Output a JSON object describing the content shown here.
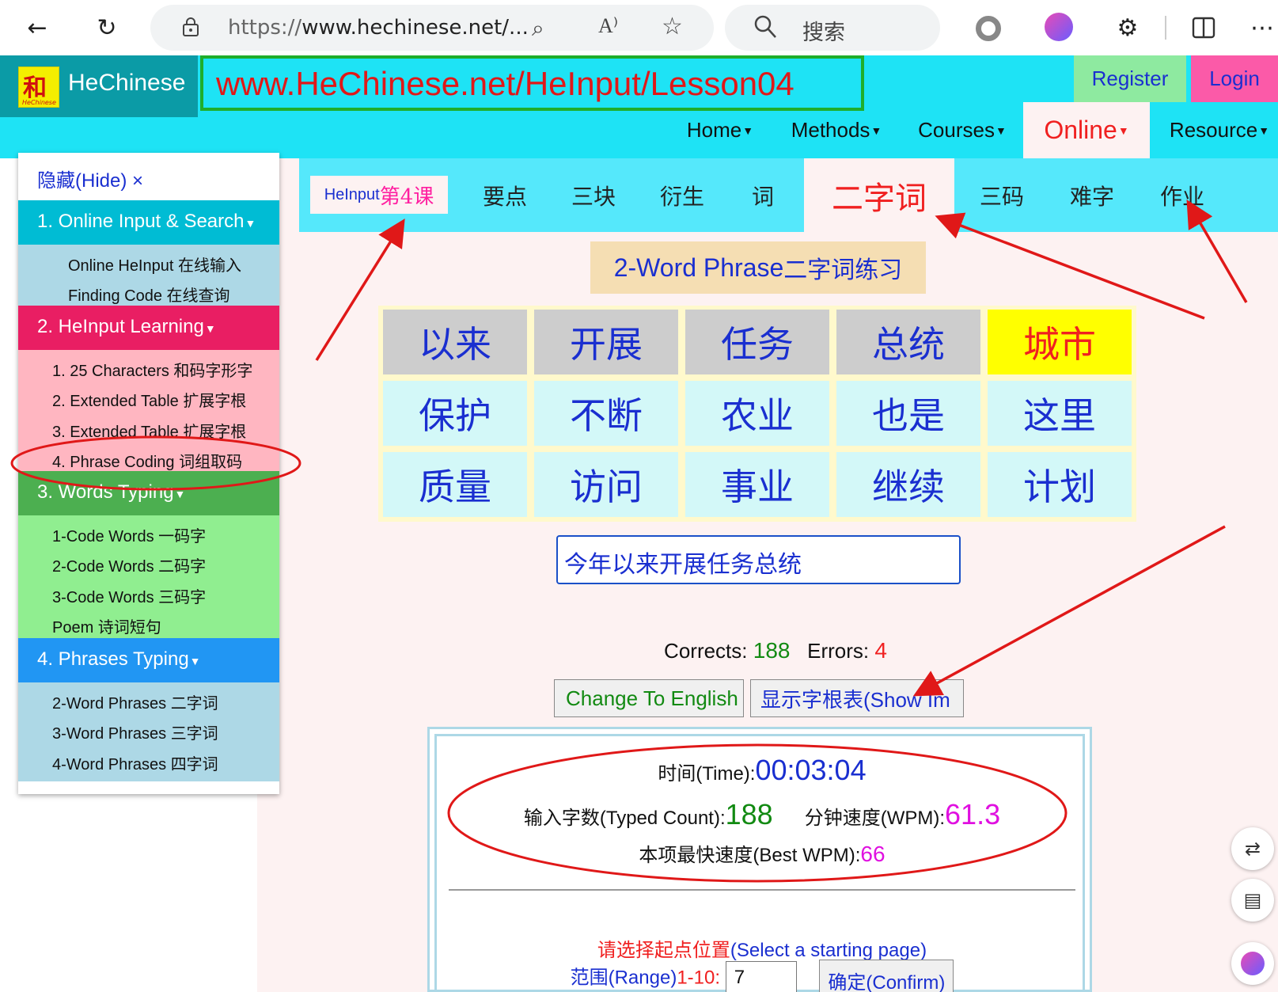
{
  "browser": {
    "url_prefix": "https://",
    "url_host": "www.hechinese.net/...",
    "search_placeholder": "搜索"
  },
  "header": {
    "brand": "HeChinese",
    "logo_char": "和",
    "logo_sub": "HeChinese",
    "site_url": "www.HeChinese.net/HeInput/Lesson04",
    "register": "Register",
    "login": "Login",
    "nav": [
      "Home",
      "Methods",
      "Courses",
      "Online",
      "Resource"
    ]
  },
  "sidebar": {
    "hide_label": "隐藏(Hide) ×",
    "sections": [
      {
        "title": "1. Online Input & Search",
        "items": [
          "Online HeInput 在线输入",
          "Finding Code 在线查询"
        ]
      },
      {
        "title": "2. HeInput Learning",
        "items": [
          "1. 25 Characters 和码字形字",
          "2. Extended Table 扩展字根",
          "3. Extended Table 扩展字根",
          "4. Phrase Coding 词组取码"
        ]
      },
      {
        "title": "3. Words Typing",
        "items": [
          "1-Code Words 一码字",
          "2-Code Words 二码字",
          "3-Code Words 三码字",
          "Poem 诗词短句"
        ]
      },
      {
        "title": "4. Phrases Typing",
        "items": [
          "2-Word Phrases 二字词",
          "3-Word Phrases 三字词",
          "4-Word Phrases 四字词"
        ]
      }
    ]
  },
  "tabs": {
    "first_prefix": "HeInput ",
    "first_suffix": "第4课",
    "items": [
      "要点",
      "三块",
      "衍生",
      "词",
      "二字词",
      "三码",
      "难字",
      "作业"
    ]
  },
  "practice": {
    "title_en": "2-Word Phrase",
    "title_zh": "二字词练习",
    "phrases": [
      [
        "以来",
        "开展",
        "任务",
        "总统",
        "城市"
      ],
      [
        "保护",
        "不断",
        "农业",
        "也是",
        "这里"
      ],
      [
        "质量",
        "访问",
        "事业",
        "继续",
        "计划"
      ]
    ],
    "input_value": "今年以来开展任务总统",
    "corrects_label": "Corrects:",
    "corrects": "188",
    "errors_label": "Errors:",
    "errors": "4",
    "btn_change": "Change To English",
    "btn_show": "显示字根表(Show Im",
    "time_label": "时间(Time):",
    "time": "00:03:04",
    "typed_label": "输入字数(Typed Count):",
    "typed": "188",
    "wpm_label": "分钟速度(WPM):",
    "wpm": "61.3",
    "best_label": "本项最快速度(Best WPM):",
    "best": "66",
    "select_zh": "请选择起点位置",
    "select_en": "(Select a starting page)",
    "range_label": "范围(Range)",
    "range_value": "1-10:",
    "range_input": "7",
    "confirm": "确定(Confirm)"
  }
}
